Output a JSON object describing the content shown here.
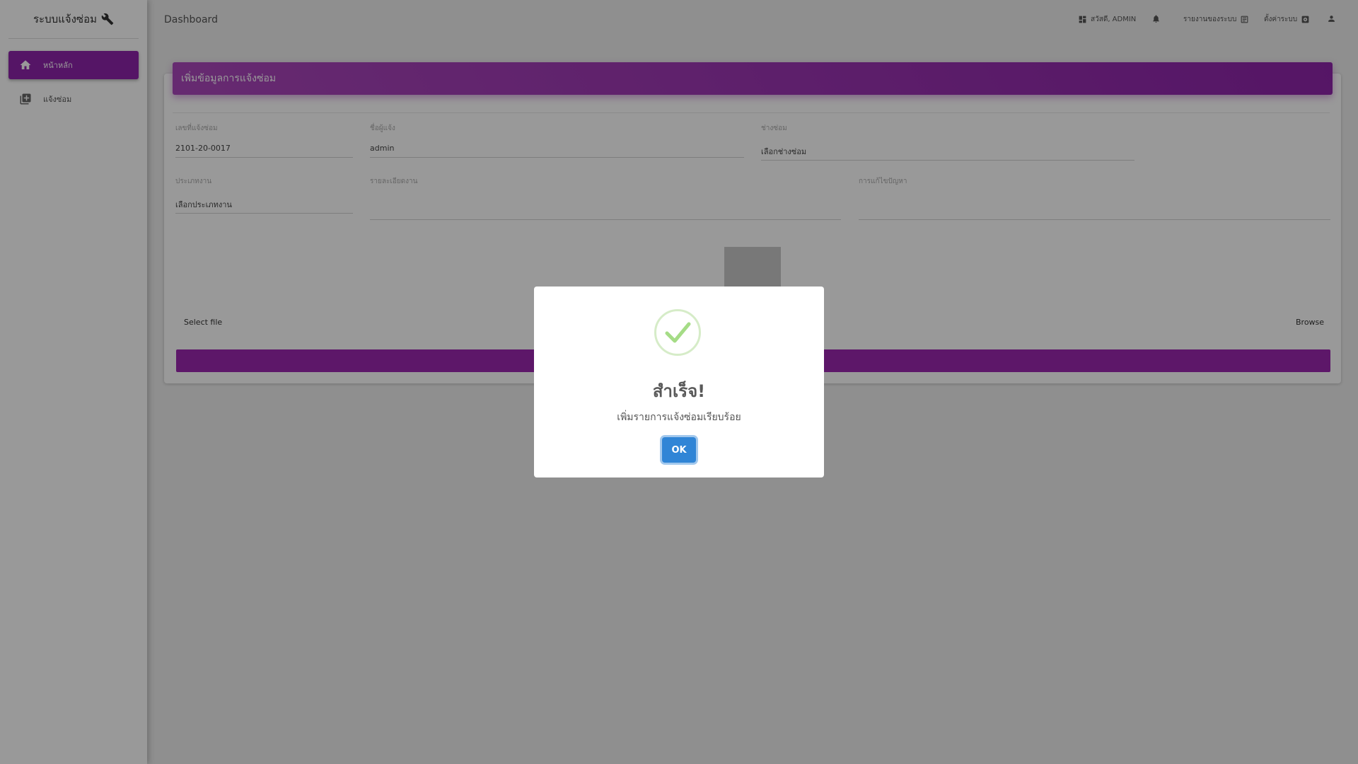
{
  "sidebar": {
    "brand": "ระบบแจ้งซ่อม",
    "brand_icon": "wrench-icon",
    "items": [
      {
        "label": "หน้าหลัก",
        "icon": "home-icon",
        "active": true
      },
      {
        "label": "แจ้งซ่อม",
        "icon": "library-add-icon",
        "active": false
      }
    ]
  },
  "topbar": {
    "title": "Dashboard",
    "greeting": "สวัสดี, ADMIN",
    "reports": "รายงานของระบบ",
    "settings": "ตั้งค่าระบบ"
  },
  "form": {
    "header": "เพิ่มข้อมูลการแจ้งซ่อม",
    "ticket_label": "เลขที่แจ้งซ่อม",
    "ticket_value": "2101-20-0017",
    "reporter_label": "ชื่อผู้แจ้ง",
    "reporter_value": "admin",
    "technician_label": "ช่างซ่อม",
    "technician_value": "เลือกช่างซ่อม",
    "type_label": "ประเภทงาน",
    "type_value": "เลือกประเภทงาน",
    "detail_label": "รายละเอียดงาน",
    "detail_value": "",
    "solution_label": "การแก้ไขปัญหา",
    "solution_value": "",
    "select_file": "Select file",
    "browse": "Browse"
  },
  "modal": {
    "title": "สำเร็จ!",
    "text": "เพิ่มรายการแจ้งซ่อมเรียบร้อย",
    "ok": "OK"
  },
  "colors": {
    "primary": "#9c27b0",
    "confirm": "#3085d6",
    "success": "#a5dc86"
  }
}
